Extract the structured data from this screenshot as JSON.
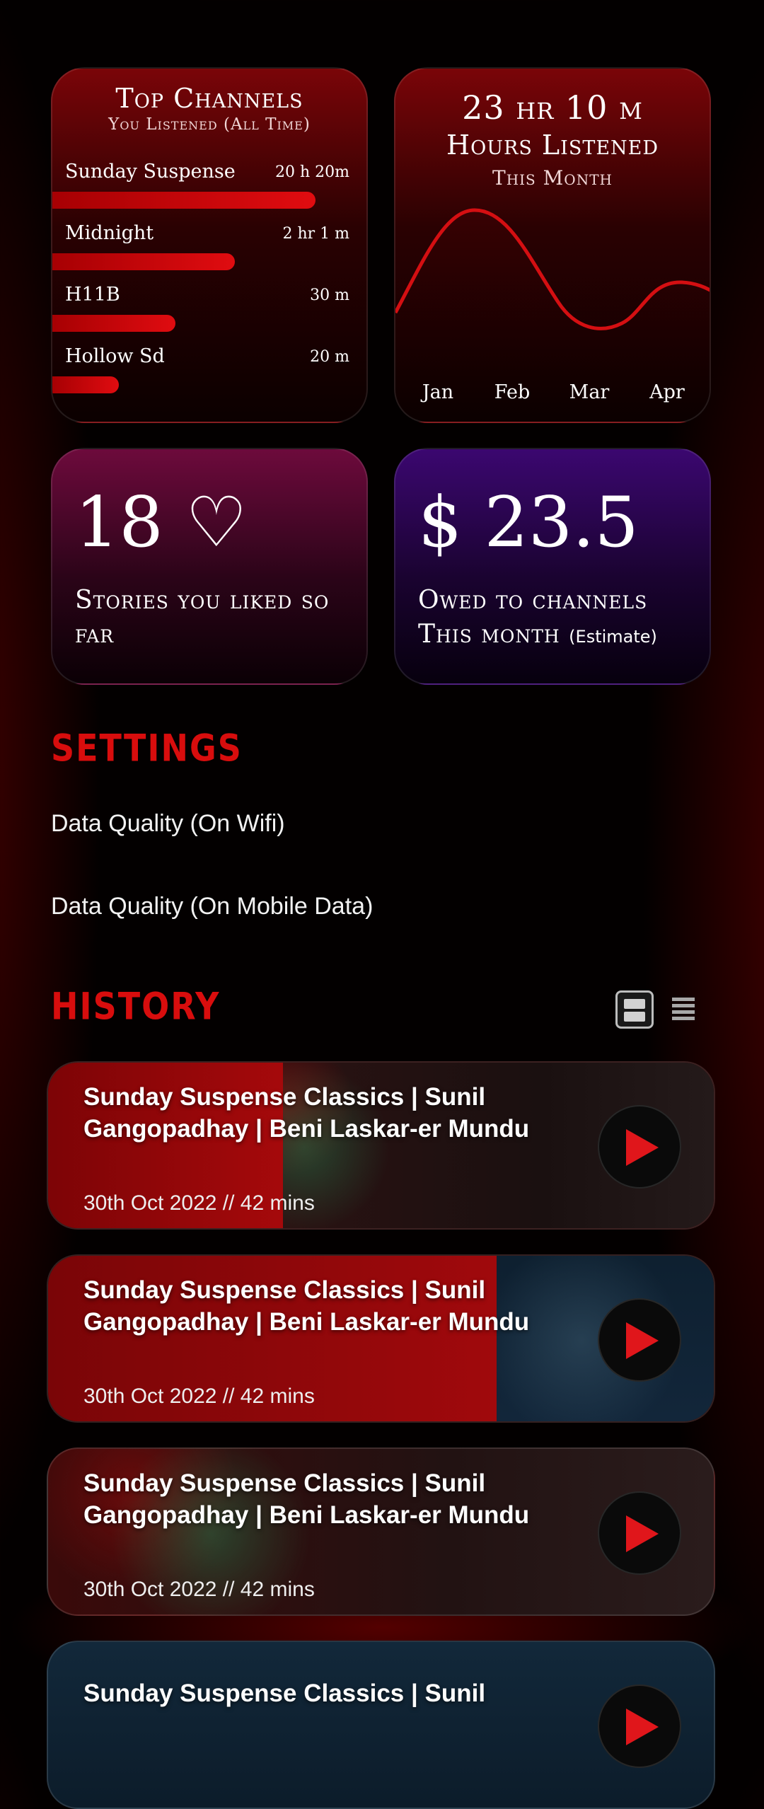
{
  "top_channels": {
    "title": "Top Channels",
    "subtitle": "You Listened (All Time)",
    "items": [
      {
        "name": "Sunday Suspense",
        "time": "20 h 20m",
        "share": 0.84
      },
      {
        "name": "Midnight",
        "time": "2 hr 1 m",
        "share": 0.58
      },
      {
        "name": "H11B",
        "time": "30 m",
        "share": 0.39
      },
      {
        "name": "Hollow Sd",
        "time": "20 m",
        "share": 0.21
      }
    ]
  },
  "hours": {
    "total": "23 hr 10 m",
    "label": "Hours Listened",
    "period": "This Month",
    "months": [
      "Jan",
      "Feb",
      "Mar",
      "Apr"
    ]
  },
  "liked": {
    "count": "18 ♡",
    "label": "Stories you liked so far"
  },
  "owed": {
    "amount": "$ 23.5",
    "label": "Owed  to channels This month",
    "note": "(Estimate)"
  },
  "settings": {
    "heading": "SETTINGS",
    "items": [
      "Data Quality (On Wifi)",
      "Data Quality (On Mobile Data)"
    ]
  },
  "history": {
    "heading": "HISTORY",
    "items": [
      {
        "title": "Sunday Suspense Classics | Sunil Gangopadhay | Beni Laskar-er Mundu",
        "meta": "30th Oct 2022 // 42 mins"
      },
      {
        "title": "Sunday Suspense Classics | Sunil Gangopadhay | Beni Laskar-er Mundu",
        "meta": "30th Oct 2022 // 42 mins"
      },
      {
        "title": "Sunday Suspense Classics | Sunil Gangopadhay | Beni Laskar-er Mundu",
        "meta": "30th Oct 2022 // 42 mins"
      },
      {
        "title": "Sunday Suspense Classics | Sunil",
        "meta": ""
      }
    ]
  },
  "colors": {
    "accent": "#d80d0d",
    "play": "#e0161b"
  }
}
